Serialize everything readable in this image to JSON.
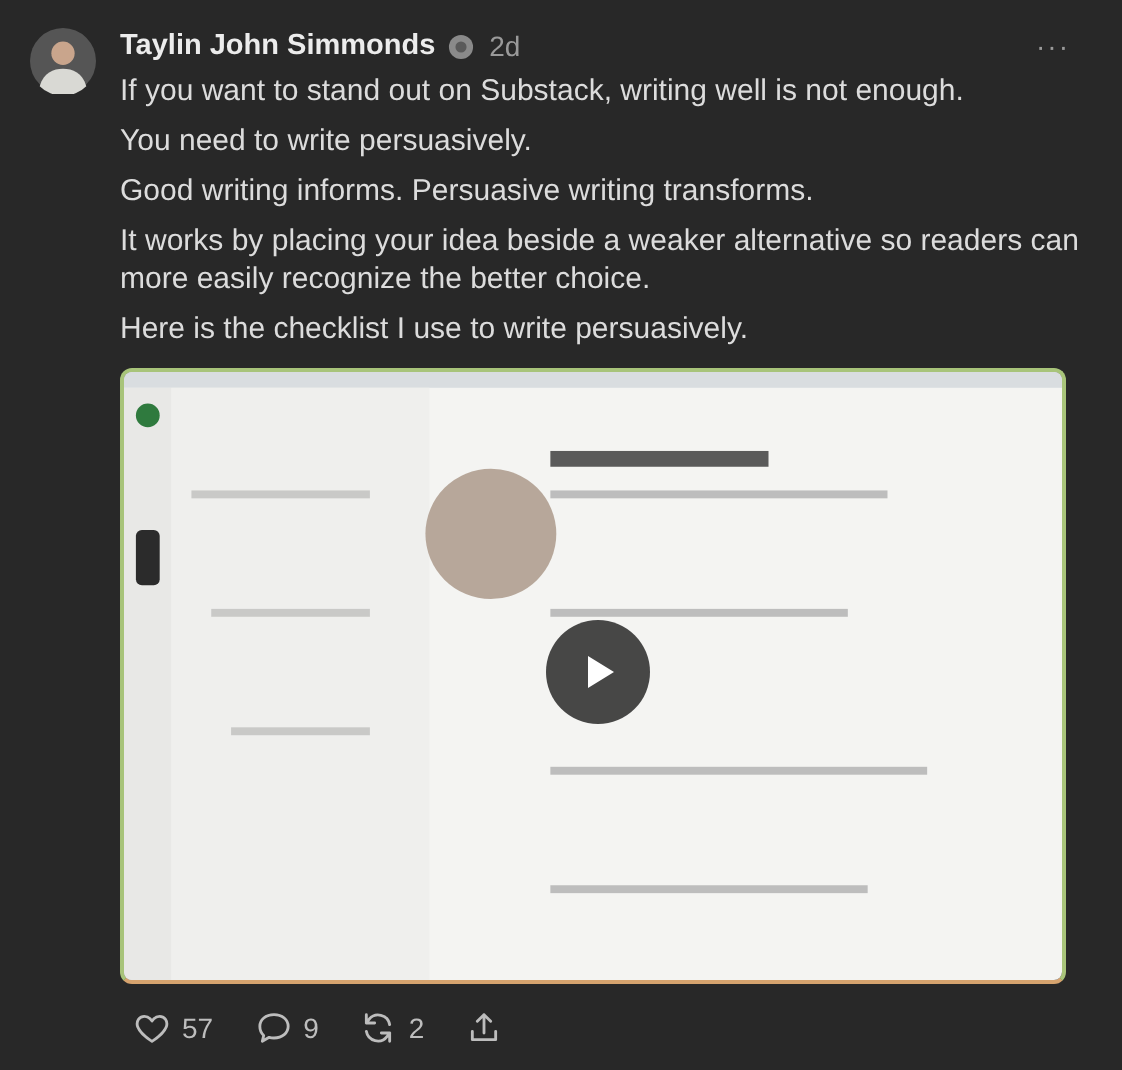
{
  "author": {
    "name": "Taylin John Simmonds",
    "time": "2d"
  },
  "more_button": "···",
  "paragraphs": [
    "If you want to stand out on Substack, writing well is not enough.",
    "You need to write persuasively.",
    "Good writing informs. Persuasive writing transforms.",
    "It works by placing your idea beside a weaker alternative so readers can more easily recognize the better choice.",
    "Here is the checklist I use to write persuasively."
  ],
  "actions": [
    {
      "kind": "like",
      "count": "57"
    },
    {
      "kind": "comment",
      "count": "9"
    },
    {
      "kind": "restack",
      "count": "2"
    },
    {
      "kind": "share"
    }
  ]
}
